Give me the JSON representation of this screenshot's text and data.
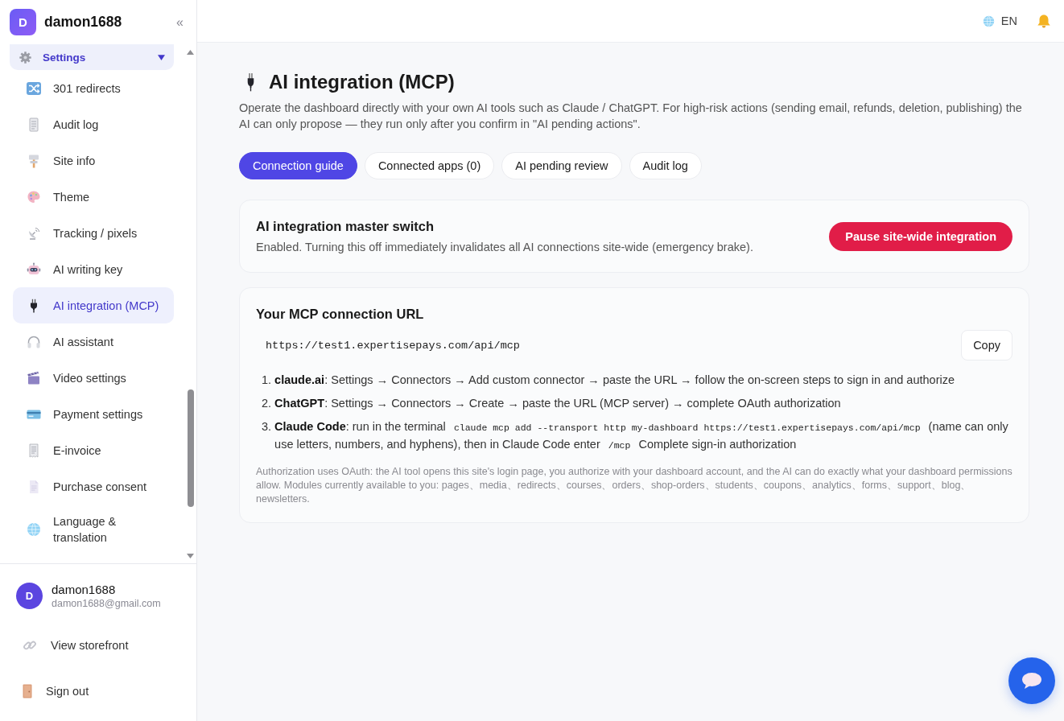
{
  "sidebar": {
    "brand": {
      "initial": "D",
      "name": "damon1688"
    },
    "collapse_button": "«",
    "group": {
      "label": "Settings",
      "expanded": true
    },
    "items": [
      {
        "label": "301 redirects",
        "selected": false
      },
      {
        "label": "Audit log",
        "selected": false
      },
      {
        "label": "Site info",
        "selected": false
      },
      {
        "label": "Theme",
        "selected": false
      },
      {
        "label": "Tracking / pixels",
        "selected": false
      },
      {
        "label": "AI writing key",
        "selected": false
      },
      {
        "label": "AI integration (MCP)",
        "selected": true
      },
      {
        "label": "AI assistant",
        "selected": false
      },
      {
        "label": "Video settings",
        "selected": false
      },
      {
        "label": "Payment settings",
        "selected": false
      },
      {
        "label": "E-invoice",
        "selected": false
      },
      {
        "label": "Purchase consent",
        "selected": false
      },
      {
        "label": "Language & translation",
        "selected": false
      }
    ],
    "user": {
      "initial": "D",
      "name": "damon1688",
      "email": "damon1688@gmail.com"
    },
    "links": [
      {
        "label": "View storefront"
      },
      {
        "label": "Sign out"
      }
    ]
  },
  "topbar": {
    "language": "EN"
  },
  "page": {
    "title": "AI integration (MCP)",
    "description": "Operate the dashboard directly with your own AI tools such as Claude / ChatGPT. For high-risk actions (sending email, refunds, deletion, publishing) the AI can only propose — they run only after you confirm in \"AI pending actions\"."
  },
  "tabs": [
    {
      "label": "Connection guide",
      "selected": true
    },
    {
      "label": "Connected apps (0)",
      "selected": false
    },
    {
      "label": "AI pending review",
      "selected": false
    },
    {
      "label": "Audit log",
      "selected": false
    }
  ],
  "master_switch": {
    "title": "AI integration master switch",
    "description": "Enabled. Turning this off immediately invalidates all AI connections site-wide (emergency brake).",
    "button": "Pause site-wide integration"
  },
  "connection": {
    "title": "Your MCP connection URL",
    "url": "https://test1.expertisepays.com/api/mcp",
    "copy_button": "Copy",
    "steps": [
      {
        "number": "1.",
        "segments": [
          {
            "kind": "bold",
            "text": "claude.ai"
          },
          {
            "kind": "text",
            "text": ": Settings → Connectors → Add custom connector → paste the URL → follow the on-screen steps to sign in and authorize"
          }
        ]
      },
      {
        "number": "2.",
        "segments": [
          {
            "kind": "bold",
            "text": "ChatGPT"
          },
          {
            "kind": "text",
            "text": ": Settings → Connectors → Create → paste the URL (MCP server) → complete OAuth authorization"
          }
        ]
      },
      {
        "number": "3.",
        "segments": [
          {
            "kind": "bold",
            "text": "Claude Code"
          },
          {
            "kind": "text",
            "text": ": run in the terminal "
          },
          {
            "kind": "code",
            "text": "claude mcp add --transport http my-dashboard https://test1.expertisepays.com/api/mcp"
          },
          {
            "kind": "text",
            "text": " (name can only use letters, numbers, and hyphens), then in Claude Code enter "
          },
          {
            "kind": "code",
            "text": "/mcp"
          },
          {
            "kind": "text",
            "text": " Complete sign-in authorization"
          }
        ]
      }
    ],
    "note": "Authorization uses OAuth: the AI tool opens this site's login page, you authorize with your dashboard account, and the AI can do exactly what your dashboard permissions allow. Modules currently available to you: pages、media、redirects、courses、orders、shop-orders、students、coupons、analytics、forms、support、blog、newsletters."
  }
}
